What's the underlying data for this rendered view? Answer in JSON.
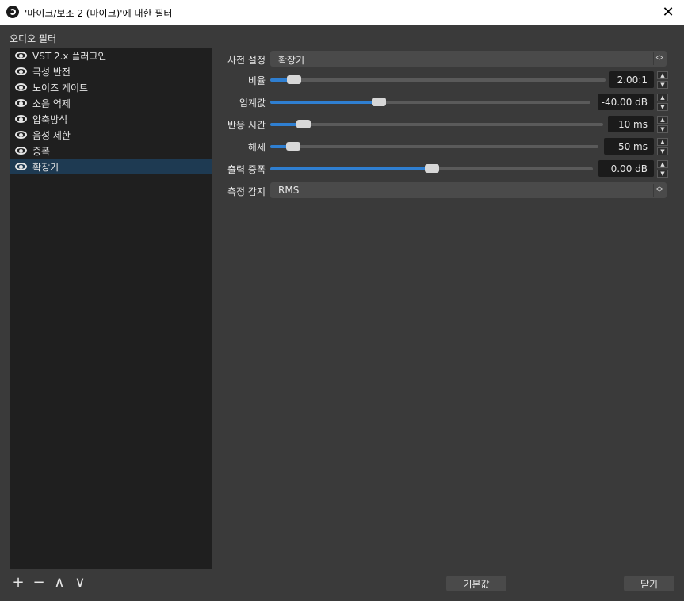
{
  "window": {
    "title": "'마이크/보조 2 (마이크)'에 대한 필터",
    "close_icon": "close-icon"
  },
  "section_label": "오디오 필터",
  "filters": [
    {
      "label": "VST 2.x 플러그인",
      "selected": false
    },
    {
      "label": "극성 반전",
      "selected": false
    },
    {
      "label": "노이즈 게이트",
      "selected": false
    },
    {
      "label": "소음 억제",
      "selected": false
    },
    {
      "label": "압축방식",
      "selected": false
    },
    {
      "label": "음성 제한",
      "selected": false
    },
    {
      "label": "증폭",
      "selected": false
    },
    {
      "label": "확장기",
      "selected": true
    }
  ],
  "bottom_tools": {
    "add": "+",
    "remove": "−",
    "up": "∧",
    "down": "∨"
  },
  "properties": {
    "preset": {
      "label": "사전 설정",
      "value": "확장기"
    },
    "ratio": {
      "label": "비율",
      "value": "2.00:1",
      "fraction": 0.07
    },
    "threshold": {
      "label": "임계값",
      "value": "-40.00 dB",
      "fraction": 0.34
    },
    "attack": {
      "label": "반응 시간",
      "value": "10 ms",
      "fraction": 0.1
    },
    "release": {
      "label": "해제",
      "value": "50 ms",
      "fraction": 0.07
    },
    "output_gain": {
      "label": "출력 증폭",
      "value": "0.00 dB",
      "fraction": 0.5
    },
    "detector": {
      "label": "측정 감지",
      "value": "RMS"
    }
  },
  "buttons": {
    "defaults": "기본값",
    "close": "닫기"
  },
  "colors": {
    "accent": "#2f7fd1",
    "selected": "#1e3a52"
  }
}
